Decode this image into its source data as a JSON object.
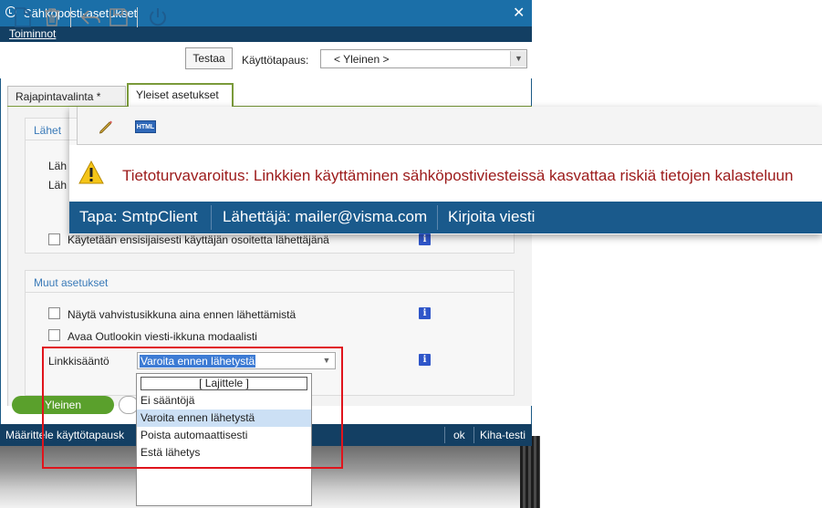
{
  "window": {
    "title": "Sähköposti-asetukset",
    "close_glyph": "✕",
    "menu": [
      "Toiminnot"
    ]
  },
  "toolbar": {
    "icons": [
      "new-document-icon",
      "delete-icon",
      "undo-icon",
      "save-icon",
      "power-icon"
    ],
    "test_button": "Testaa",
    "mode_label": "Käyttötapaus:",
    "mode_value": "< Yleinen >"
  },
  "tabs": [
    {
      "label": "Rajapintavalinta *",
      "active": false
    },
    {
      "label": "Yleiset asetukset",
      "active": true
    }
  ],
  "group_send": {
    "title": "Lähet",
    "label_1": "Läh",
    "label_2": "Läh",
    "checkbox_label": "Käytetään ensisijaisesti käyttäjän osoitetta lähettäjänä"
  },
  "group_other": {
    "title": "Muut asetukset",
    "checkbox_1": "Näytä vahvistusikkuna aina ennen lähettämistä",
    "checkbox_2": "Avaa Outlookin viesti-ikkuna modaalisti",
    "link_rule_label": "Linkkisääntö",
    "link_rule_value": "Varoita ennen lähetystä"
  },
  "dropdown": {
    "sort_label": "[ Lajittele ]",
    "options": [
      "Ei sääntöjä",
      "Varoita ennen lähetystä",
      "Poista automaattisesti",
      "Estä lähetys"
    ],
    "selected_index": 1
  },
  "bottom": {
    "primary_button": "Yleinen"
  },
  "statusbar": {
    "text": "Määrittele käyttötapausk",
    "ok": "ok",
    "user": "Kiha-testi"
  },
  "overlay": {
    "html_badge": "HTML",
    "warning": "Tietoturvavaroitus: Linkkien käyttäminen sähköpostiviesteissä kasvattaa riskiä tietojen kalasteluun",
    "status": {
      "method": "Tapa: SmtpClient",
      "sender": "Lähettäjä: mailer@visma.com",
      "action": "Kirjoita viesti"
    }
  },
  "colors": {
    "title_bar": "#1b6fa8",
    "menu_bar": "#133f63",
    "tab_accent": "#7a9a3a",
    "warning_text": "#9c1a1a",
    "highlight_border": "#e0141c",
    "primary_button": "#5aa02c"
  }
}
